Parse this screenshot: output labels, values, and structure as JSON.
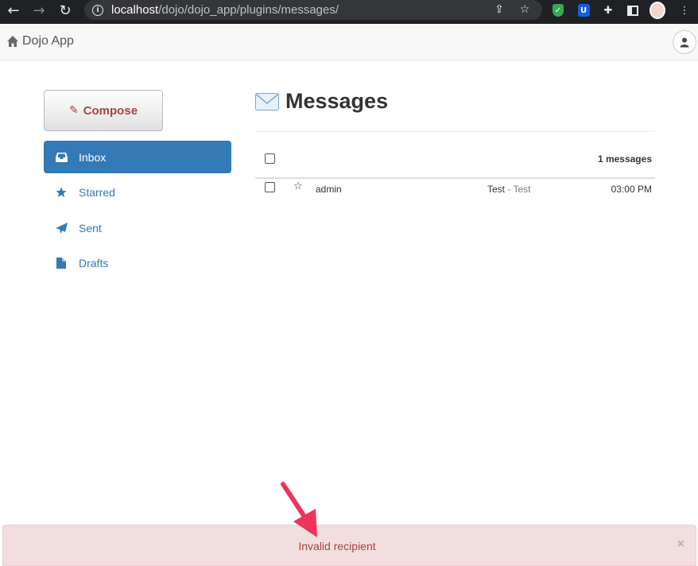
{
  "browser": {
    "url_host": "localhost",
    "url_path": "/dojo/dojo_app/plugins/messages/"
  },
  "navbar": {
    "brand": "Dojo App"
  },
  "sidebar": {
    "compose_label": "Compose",
    "items": [
      {
        "label": "Inbox",
        "icon": "inbox-icon",
        "active": true
      },
      {
        "label": "Starred",
        "icon": "star-icon"
      },
      {
        "label": "Sent",
        "icon": "paper-plane-icon"
      },
      {
        "label": "Drafts",
        "icon": "file-icon"
      }
    ]
  },
  "main": {
    "title": "Messages",
    "count_label": "1 messages",
    "messages": [
      {
        "from": "admin",
        "subject": "Test",
        "snippet": "- Test",
        "time": "03:00 PM",
        "starred": false
      }
    ]
  },
  "alert": {
    "message": "Invalid recipient",
    "close": "×"
  },
  "colors": {
    "accent": "#337ab7",
    "danger_text": "#a94442",
    "danger_bg": "#f2dede",
    "annotation_arrow": "#f0335a"
  }
}
